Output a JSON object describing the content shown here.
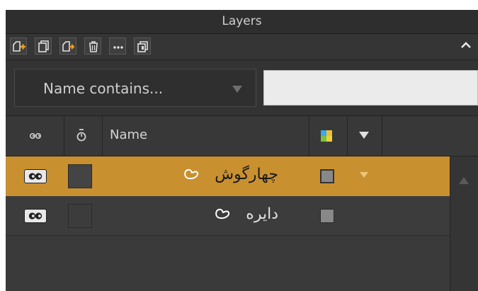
{
  "panel": {
    "title": "Layers",
    "toolbar": [
      {
        "icon": "new-layer-icon"
      },
      {
        "icon": "duplicate-layer-icon"
      },
      {
        "icon": "move-layer-icon"
      },
      {
        "icon": "trash-icon"
      },
      {
        "icon": "more-options-icon"
      },
      {
        "icon": "group-layers-icon"
      }
    ],
    "collapse_icon": "chevron-up-icon"
  },
  "filter": {
    "label": "Name contains...",
    "value": ""
  },
  "columns": {
    "visibility_icon": "eye-icon",
    "lock_icon": "stopwatch-icon",
    "name": "Name",
    "color_icon": "color-label-icon",
    "menu_icon": "triangle-down-icon"
  },
  "layers": [
    {
      "name": "چهارگوش",
      "shape_icon": "shape-layer-icon",
      "selected": true
    },
    {
      "name": "دایره",
      "shape_icon": "shape-layer-icon",
      "selected": false
    }
  ],
  "colors": {
    "selected_row": "#c99030",
    "panel_bg": "#3c3c3c"
  }
}
